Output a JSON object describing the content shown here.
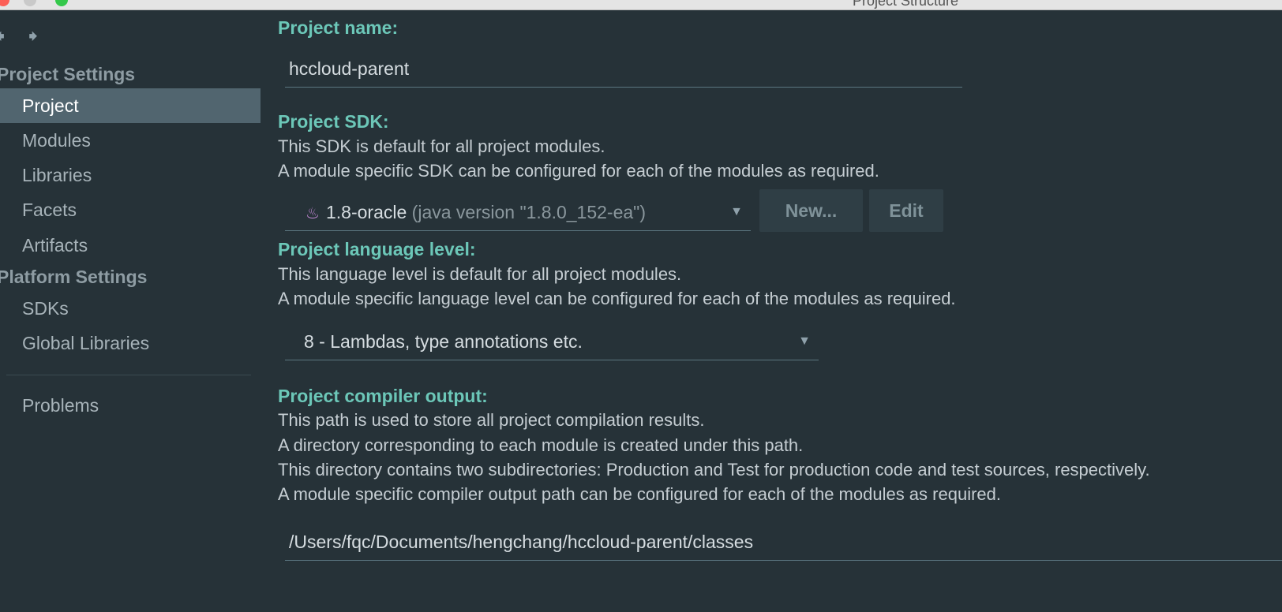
{
  "window": {
    "title": "Project Structure"
  },
  "nav": {
    "back_icon": "arrow-left-icon",
    "forward_icon": "arrow-right-icon"
  },
  "sidebar": {
    "project_settings_header": "Project Settings",
    "project_items": [
      {
        "label": "Project",
        "selected": true
      },
      {
        "label": "Modules",
        "selected": false
      },
      {
        "label": "Libraries",
        "selected": false
      },
      {
        "label": "Facets",
        "selected": false
      },
      {
        "label": "Artifacts",
        "selected": false
      }
    ],
    "platform_settings_header": "Platform Settings",
    "platform_items": [
      {
        "label": "SDKs"
      },
      {
        "label": "Global Libraries"
      }
    ],
    "problems_label": "Problems"
  },
  "main": {
    "project_name": {
      "label": "Project name:",
      "value": "hccloud-parent"
    },
    "project_sdk": {
      "label": "Project SDK:",
      "desc_line1": "This SDK is default for all project modules.",
      "desc_line2": "A module specific SDK can be configured for each of the modules as required.",
      "selected_name": "1.8-oracle",
      "selected_detail": "(java version \"1.8.0_152-ea\")",
      "new_button": "New...",
      "edit_button": "Edit"
    },
    "language_level": {
      "label": "Project language level:",
      "desc_line1": "This language level is default for all project modules.",
      "desc_line2": "A module specific language level can be configured for each of the modules as required.",
      "selected": "8 - Lambdas, type annotations etc."
    },
    "compiler_output": {
      "label": "Project compiler output:",
      "desc_line1": "This path is used to store all project compilation results.",
      "desc_line2": "A directory corresponding to each module is created under this path.",
      "desc_line3": "This directory contains two subdirectories: Production and Test for production code and test sources, respectively.",
      "desc_line4": "A module specific compiler output path can be configured for each of the modules as required.",
      "path": "/Users/fqc/Documents/hengchang/hccloud-parent/classes"
    }
  },
  "colors": {
    "background": "#263238",
    "accent_label": "#6cc7b8",
    "selection": "#51656f"
  }
}
